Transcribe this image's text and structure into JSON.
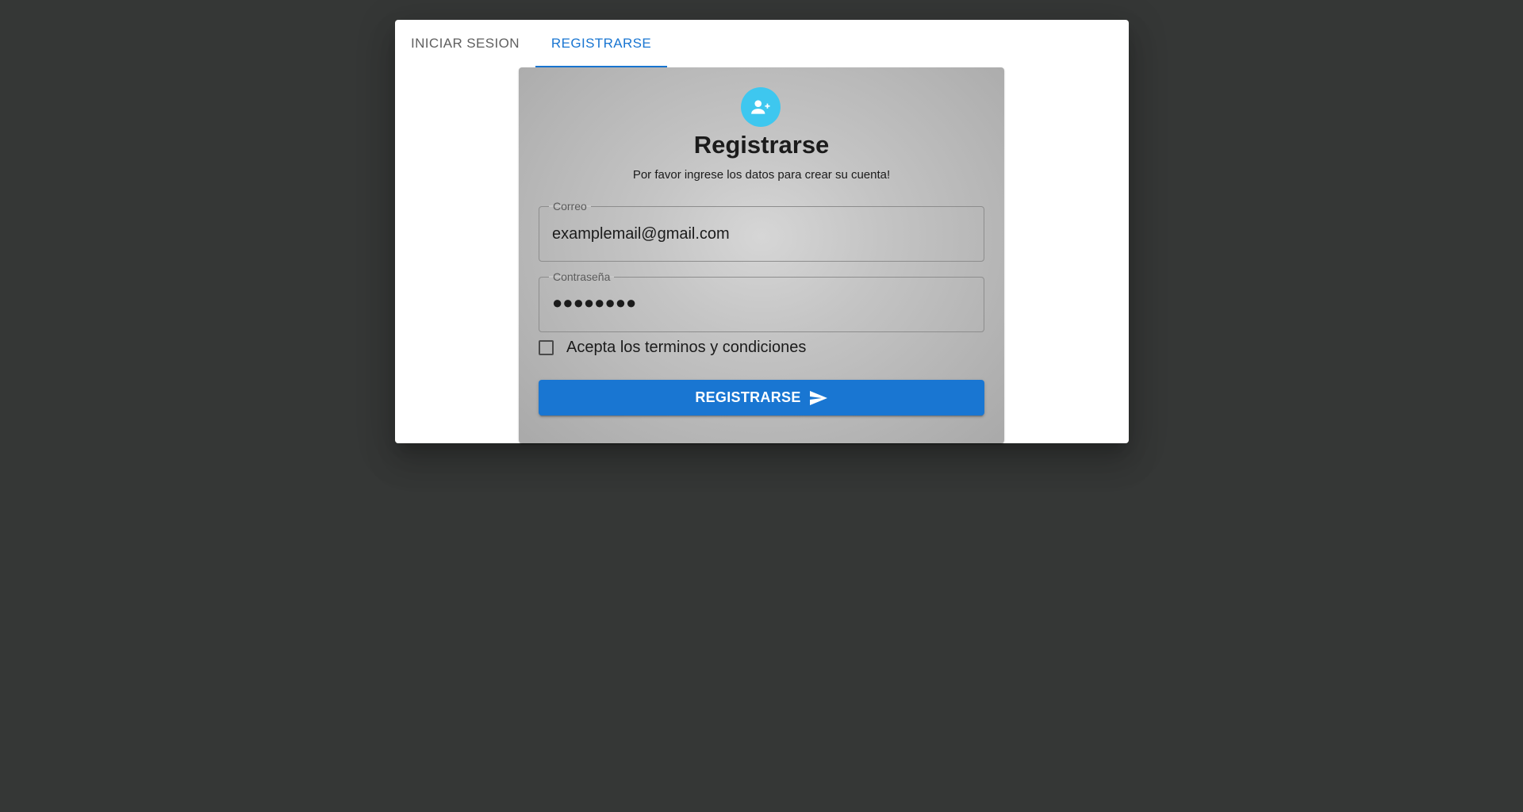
{
  "tabs": [
    {
      "label": "INICIAR SESION",
      "active": false
    },
    {
      "label": "REGISTRARSE",
      "active": true
    }
  ],
  "form": {
    "icon": "person-add-icon",
    "title": "Registrarse",
    "subtitle": "Por favor ingrese los datos para crear su cuenta!",
    "email": {
      "label": "Correo",
      "value": "examplemail@gmail.com"
    },
    "password": {
      "label": "Contraseña",
      "masked_value": "●●●●●●●●"
    },
    "terms": {
      "label": "Acepta los terminos y condiciones",
      "checked": false
    },
    "submit": {
      "label": "REGISTRARSE",
      "icon": "send-icon"
    }
  },
  "colors": {
    "background": "#353736",
    "accent": "#1976d2",
    "avatar": "#3ec7ef"
  }
}
